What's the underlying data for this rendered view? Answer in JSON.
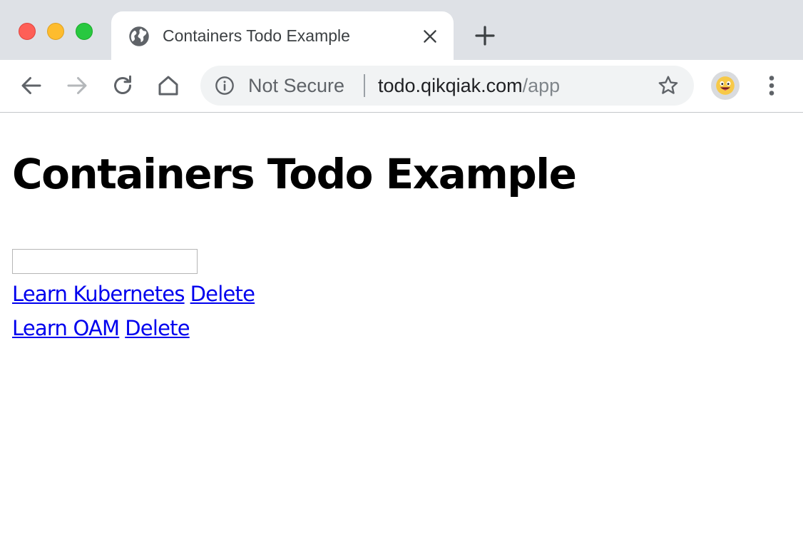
{
  "browser": {
    "tab": {
      "title": "Containers Todo Example"
    },
    "address_bar": {
      "security_label": "Not Secure",
      "url_host": "todo.qikqiak.com",
      "url_path": "/app"
    },
    "icons": {
      "favicon": "globe-icon",
      "close": "close-icon",
      "new_tab": "plus-icon",
      "back": "back-arrow-icon",
      "forward": "forward-arrow-icon",
      "reload": "reload-icon",
      "home": "home-icon",
      "info": "info-icon",
      "bookmark": "star-icon",
      "profile": "avatar-emoji-icon",
      "menu": "kebab-menu-icon"
    },
    "colors": {
      "tabstrip": "#dee1e6",
      "link": "#0000ee",
      "traffic_red": "#fe5f57",
      "traffic_yellow": "#febc2e",
      "traffic_green": "#28c840"
    }
  },
  "page": {
    "heading": "Containers Todo Example",
    "new_todo_input": {
      "value": "",
      "placeholder": ""
    },
    "todos": [
      {
        "label": "Learn Kubernetes",
        "delete_label": "Delete"
      },
      {
        "label": "Learn OAM",
        "delete_label": "Delete"
      }
    ]
  }
}
